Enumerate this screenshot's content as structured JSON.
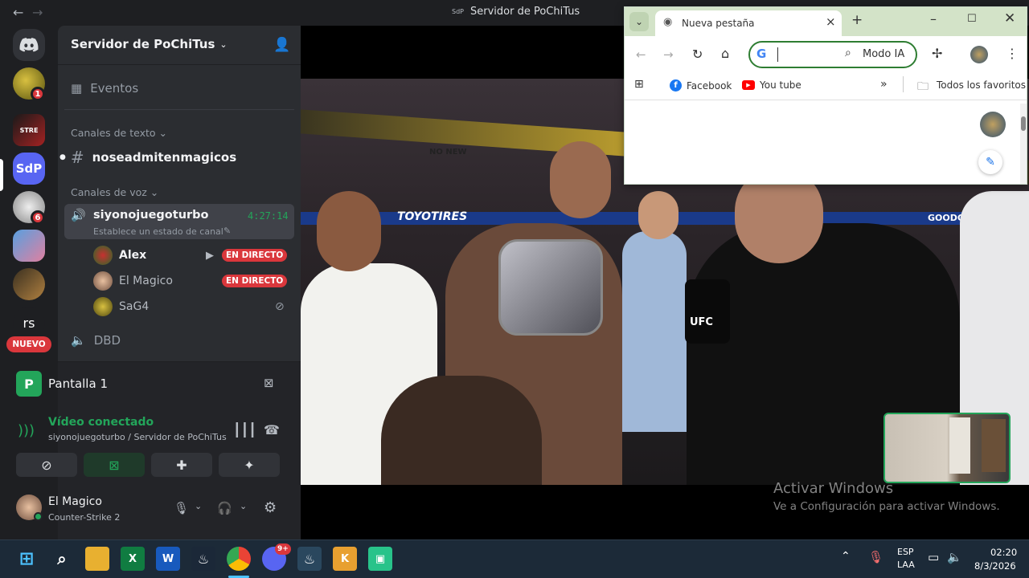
{
  "window": {
    "title": "Servidor de PoChiTus",
    "back": "←",
    "forward": "→"
  },
  "rail": {
    "servers": [
      {
        "name": "server-1",
        "badge": "1"
      },
      {
        "name": "server-2",
        "label": "STRE"
      },
      {
        "name": "server-sdp",
        "label": "SdP"
      },
      {
        "name": "server-4",
        "badge": "6"
      },
      {
        "name": "server-5"
      },
      {
        "name": "server-6"
      },
      {
        "name": "server-rs",
        "label": "rs"
      }
    ],
    "new_badge": "NUEVO"
  },
  "sidebar": {
    "server_name": "Servidor de PoChiTus",
    "events": "Eventos",
    "text_category": "Canales de texto",
    "text_channel": "noseadmitenmagicos",
    "voice_category": "Canales de voz",
    "voice_channel": {
      "name": "siyonojuegoturbo",
      "timer": "4:27:14",
      "status": "Establece un estado de canal"
    },
    "members": [
      {
        "name": "Alex",
        "live": "EN DIRECTO"
      },
      {
        "name": "El Magico",
        "live": "EN DIRECTO"
      },
      {
        "name": "SaG4"
      }
    ],
    "other_voice": "DBD"
  },
  "stream_panel": {
    "title": "Pantalla 1"
  },
  "voice_panel": {
    "status": "Vídeo conectado",
    "location": "siyonojuegoturbo / Servidor de PoChiTus"
  },
  "user_panel": {
    "name": "El Magico",
    "activity": "Counter-Strike 2"
  },
  "video": {
    "banner_left": "TOYOTIRES",
    "banner_right": "GOODGREEK.COM",
    "mic_label": "UFC",
    "rope_text": "NO NEW"
  },
  "activation": {
    "title": "Activar Windows",
    "subtitle": "Ve a Configuración para activar Windows."
  },
  "chrome": {
    "tab_title": "Nueva pestaña",
    "ai_mode": "Modo IA",
    "bookmarks": [
      "Facebook",
      "You tube"
    ],
    "all_bookmarks": "Todos los favoritos"
  },
  "taskbar": {
    "lang_top": "ESP",
    "lang_bottom": "LAA",
    "time": "02:20",
    "date": "8/3/2026",
    "discord_badge": "9+",
    "colors": {
      "accent": "#5865f2",
      "live": "#da373c",
      "connected": "#23a55a"
    }
  }
}
